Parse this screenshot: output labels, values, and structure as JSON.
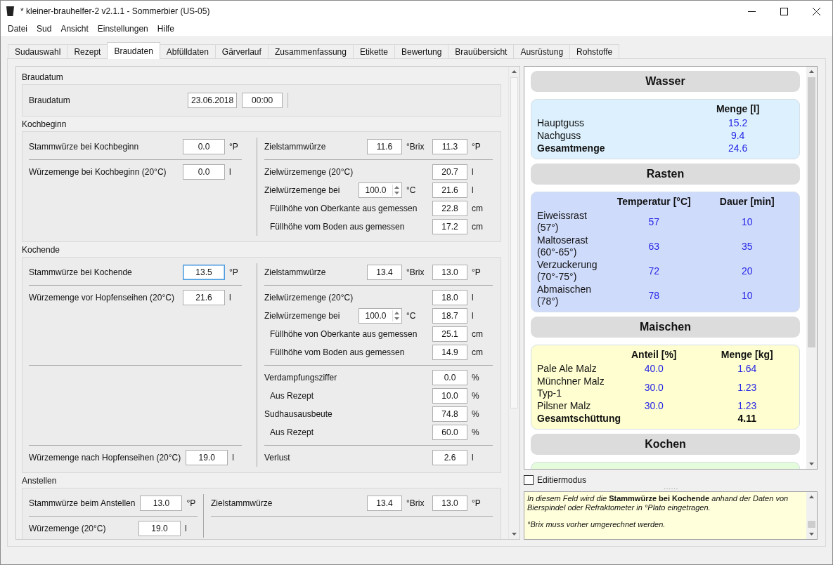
{
  "window": {
    "title": "* kleiner-brauhelfer-2 v2.1.1 - Sommerbier (US-05)"
  },
  "menu": [
    "Datei",
    "Sud",
    "Ansicht",
    "Einstellungen",
    "Hilfe"
  ],
  "tabs": [
    {
      "label": "Sudauswahl",
      "selected": false
    },
    {
      "label": "Rezept",
      "selected": false
    },
    {
      "label": "Braudaten",
      "selected": true
    },
    {
      "label": "Abfülldaten",
      "selected": false
    },
    {
      "label": "Gärverlauf",
      "selected": false
    },
    {
      "label": "Zusammenfassung",
      "selected": false
    },
    {
      "label": "Etikette",
      "selected": false
    },
    {
      "label": "Bewertung",
      "selected": false
    },
    {
      "label": "Brauübersicht",
      "selected": false
    },
    {
      "label": "Ausrüstung",
      "selected": false
    },
    {
      "label": "Rohstoffe",
      "selected": false
    }
  ],
  "sections": [
    {
      "title": "Braudatum",
      "kind": "date",
      "rows": [
        {
          "label": "Braudatum",
          "inputs": [
            {
              "kind": "field",
              "value": "23.06.2018",
              "focused": false
            },
            {
              "kind": "field",
              "value": "00:00",
              "focused": false
            }
          ]
        }
      ]
    },
    {
      "title": "Kochbeginn",
      "kind": "split",
      "bands": [
        {
          "left": [
            {
              "label": "Stammwürze bei Kochbeginn",
              "inputs": [
                {
                  "kind": "field",
                  "value": "0.0",
                  "unit": "°P",
                  "focused": false
                }
              ]
            }
          ],
          "right": [
            {
              "label": "Zielstammwürze",
              "inputs": [
                {
                  "kind": "field",
                  "value": "11.6",
                  "unit": "°Brix",
                  "focused": false
                },
                {
                  "kind": "field",
                  "value": "11.3",
                  "unit": "°P",
                  "focused": false
                }
              ]
            }
          ]
        },
        {
          "left": [
            {
              "label": "Würzemenge bei Kochbeginn (20°C)",
              "inputs": [
                {
                  "kind": "field",
                  "value": "0.0",
                  "unit": "l",
                  "focused": false
                }
              ]
            }
          ],
          "right": [
            {
              "label": "Zielwürzemenge (20°C)",
              "inputs": [
                {
                  "kind": "field",
                  "value": "20.7",
                  "unit": "l",
                  "focused": false
                }
              ]
            },
            {
              "label": "Zielwürzemenge bei",
              "inputs": [
                {
                  "kind": "spin",
                  "value": "100.0",
                  "unit": "°C",
                  "focused": false
                },
                {
                  "kind": "field",
                  "value": "21.6",
                  "unit": "l",
                  "focused": false
                }
              ],
              "children": [
                {
                  "label": "Füllhöhe von Oberkante aus gemessen",
                  "inputs": [
                    {
                      "kind": "field",
                      "value": "22.8",
                      "unit": "cm",
                      "focused": false
                    }
                  ]
                },
                {
                  "label": "Füllhöhe vom Boden aus gemessen",
                  "inputs": [
                    {
                      "kind": "field",
                      "value": "17.2",
                      "unit": "cm",
                      "focused": false
                    }
                  ]
                }
              ]
            }
          ]
        }
      ]
    },
    {
      "title": "Kochende",
      "kind": "split",
      "bands": [
        {
          "left": [
            {
              "label": "Stammwürze bei Kochende",
              "inputs": [
                {
                  "kind": "field",
                  "value": "13.5",
                  "unit": "°P",
                  "focused": true
                }
              ]
            }
          ],
          "right": [
            {
              "label": "Zielstammwürze",
              "inputs": [
                {
                  "kind": "field",
                  "value": "13.4",
                  "unit": "°Brix",
                  "focused": false
                },
                {
                  "kind": "field",
                  "value": "13.0",
                  "unit": "°P",
                  "focused": false
                }
              ]
            }
          ]
        },
        {
          "left": [
            {
              "label": "Würzemenge vor Hopfenseihen (20°C)",
              "inputs": [
                {
                  "kind": "field",
                  "value": "21.6",
                  "unit": "l",
                  "focused": false
                }
              ]
            }
          ],
          "right": [
            {
              "label": "Zielwürzemenge (20°C)",
              "inputs": [
                {
                  "kind": "field",
                  "value": "18.0",
                  "unit": "l",
                  "focused": false
                }
              ]
            },
            {
              "label": "Zielwürzemenge bei",
              "inputs": [
                {
                  "kind": "spin",
                  "value": "100.0",
                  "unit": "°C",
                  "focused": false
                },
                {
                  "kind": "field",
                  "value": "18.7",
                  "unit": "l",
                  "focused": false
                }
              ],
              "children": [
                {
                  "label": "Füllhöhe von Oberkante aus gemessen",
                  "inputs": [
                    {
                      "kind": "field",
                      "value": "25.1",
                      "unit": "cm",
                      "focused": false
                    }
                  ]
                },
                {
                  "label": "Füllhöhe vom Boden aus gemessen",
                  "inputs": [
                    {
                      "kind": "field",
                      "value": "14.9",
                      "unit": "cm",
                      "focused": false
                    }
                  ]
                }
              ]
            }
          ]
        },
        {
          "right": [
            {
              "label": "Verdampfungsziffer",
              "inputs": [
                {
                  "kind": "field",
                  "value": "0.0",
                  "unit": "%",
                  "focused": false
                }
              ],
              "children": [
                {
                  "label": "Aus Rezept",
                  "inputs": [
                    {
                      "kind": "field",
                      "value": "10.0",
                      "unit": "%",
                      "focused": false
                    }
                  ]
                }
              ]
            },
            {
              "label": "Sudhausausbeute",
              "inputs": [
                {
                  "kind": "field",
                  "value": "74.8",
                  "unit": "%",
                  "focused": false
                }
              ],
              "children": [
                {
                  "label": "Aus Rezept",
                  "inputs": [
                    {
                      "kind": "field",
                      "value": "60.0",
                      "unit": "%",
                      "focused": false
                    }
                  ]
                }
              ]
            }
          ]
        },
        {
          "left": [
            {
              "label": "Würzemenge nach Hopfenseihen (20°C)",
              "inputs": [
                {
                  "kind": "field",
                  "value": "19.0",
                  "unit": "l",
                  "focused": false
                }
              ]
            }
          ],
          "right": [
            {
              "label": "Verlust",
              "inputs": [
                {
                  "kind": "field",
                  "value": "2.6",
                  "unit": "l",
                  "focused": false
                }
              ]
            }
          ]
        }
      ]
    },
    {
      "title": "Anstellen",
      "kind": "split-narrow",
      "bands": [
        {
          "left": [
            {
              "label": "Stammwürze beim Anstellen",
              "inputs": [
                {
                  "kind": "field",
                  "value": "13.0",
                  "unit": "°P",
                  "focused": false
                }
              ]
            }
          ],
          "right": [
            {
              "label": "Zielstammwürze",
              "inputs": [
                {
                  "kind": "field",
                  "value": "13.4",
                  "unit": "°Brix",
                  "focused": false
                },
                {
                  "kind": "field",
                  "value": "13.0",
                  "unit": "°P",
                  "focused": false
                }
              ]
            }
          ]
        },
        {
          "left": [
            {
              "label": "Würzemenge (20°C)",
              "inputs": [
                {
                  "kind": "field",
                  "value": "19.0",
                  "unit": "l",
                  "focused": false
                }
              ]
            }
          ]
        }
      ]
    }
  ],
  "summary": [
    {
      "title": "Wasser",
      "color": "#dcf0fd",
      "table": {
        "columns": [
          "Menge [l]"
        ],
        "rows": [
          {
            "label": "Hauptguss",
            "bold": false,
            "values": [
              "15.2"
            ]
          },
          {
            "label": "Nachguss",
            "bold": false,
            "values": [
              "9.4"
            ]
          },
          {
            "label": "Gesamtmenge",
            "bold": true,
            "values": [
              "24.6"
            ]
          }
        ]
      }
    },
    {
      "title": "Rasten",
      "color": "#cfdbfb",
      "table": {
        "columns": [
          "Temperatur [°C]",
          "Dauer [min]"
        ],
        "rows": [
          {
            "label": "Eiweissrast (57°)",
            "bold": false,
            "values": [
              "57",
              "10"
            ]
          },
          {
            "label": "Maltoserast (60°-65°)",
            "bold": false,
            "values": [
              "63",
              "35"
            ]
          },
          {
            "label": "Verzuckerung (70°-75°)",
            "bold": false,
            "values": [
              "72",
              "20"
            ]
          },
          {
            "label": "Abmaischen (78°)",
            "bold": false,
            "values": [
              "78",
              "10"
            ]
          }
        ]
      }
    },
    {
      "title": "Maischen",
      "color": "#fefed0",
      "table": {
        "columns": [
          "Anteil [%]",
          "Menge [kg]"
        ],
        "rows": [
          {
            "label": "Pale Ale Malz",
            "bold": false,
            "values": [
              "40.0",
              "1.64"
            ]
          },
          {
            "label": "Münchner Malz Typ-1",
            "bold": false,
            "values": [
              "30.0",
              "1.23"
            ]
          },
          {
            "label": "Pilsner Malz",
            "bold": false,
            "values": [
              "30.0",
              "1.23"
            ]
          }
        ],
        "total": {
          "label": "Gesamtschüttung",
          "value": "4.11"
        }
      }
    },
    {
      "title": "Kochen",
      "color": "#e4fcdb"
    }
  ],
  "editmode": {
    "label": "Editiermodus",
    "checked": false
  },
  "help": [
    "*In diesem Feld wird die* **Stammwürze bei Kochende** *anhand der Daten von Bierspindel oder Refraktometer in °Plato eingetragen.*",
    "°Brix muss vorher umgerechnet werden."
  ]
}
